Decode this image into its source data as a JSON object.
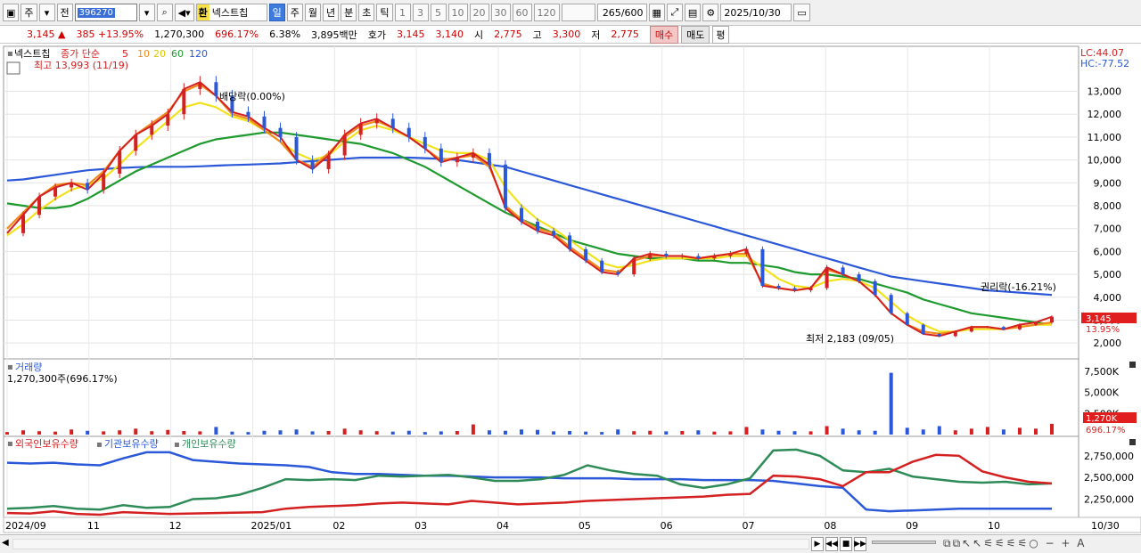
{
  "toolbar": {
    "type_label": "주",
    "prev_label": "전",
    "stock_code": "396270",
    "hwan_label": "환",
    "stock_name": "넥스트칩",
    "periods": [
      "일",
      "주",
      "월",
      "년",
      "분",
      "초",
      "틱"
    ],
    "active_period": "일",
    "intervals": [
      "1",
      "3",
      "5",
      "10",
      "20",
      "30",
      "60",
      "120"
    ],
    "count": "265",
    "count_max": "/600",
    "date": "2025/10/30"
  },
  "quote": {
    "price": "3,145",
    "change": "385",
    "change_pct": "+13.95%",
    "volume": "1,270,300",
    "volume_ratio": "696.17%",
    "turnover": "6.38%",
    "amount": "3,895백만",
    "bid_label": "호가",
    "ask": "3,145",
    "bid": "3,140",
    "open_label": "시",
    "open": "2,775",
    "high_label": "고",
    "high": "3,300",
    "low_label": "저",
    "low": "2,775",
    "buy_label": "매수",
    "sell_label": "매도",
    "flat_label": "평"
  },
  "price_panel": {
    "legend_name": "넥스트칩",
    "legend_ma": "종가 단순",
    "ma_labels": [
      "5",
      "10",
      "20",
      "60",
      "120"
    ],
    "ma_colors": [
      "#d42020",
      "#f08a1c",
      "#f2e21c",
      "#1e9a2e",
      "#2a58d8"
    ],
    "lc": "LC:44.07",
    "hc": "HC:-77.52",
    "high_note": "최고 13,993 (11/19)",
    "low_note": "최저 2,183 (09/05)",
    "dividend_note": "배당락(0.00%)",
    "rights_note": "권리락(-16.21%)",
    "current_price_tag": "3,145",
    "current_pct_tag": "13.95%",
    "y_ticks": [
      "13,000",
      "12,000",
      "11,000",
      "10,000",
      "9,000",
      "8,000",
      "7,000",
      "6,000",
      "5,000",
      "4,000",
      "3,000",
      "2,000"
    ]
  },
  "volume_panel": {
    "title": "거래량",
    "value": "1,270,300주(696.17%)",
    "y_ticks": [
      "7,500K",
      "5,000K",
      "2,500K"
    ],
    "tag_value": "1,270K",
    "tag_pct": "696.17%"
  },
  "holding_panel": {
    "series": [
      "외국인보유수량",
      "기관보유수량",
      "개인보유수량"
    ],
    "series_colors": [
      "#d42020",
      "#2a58d8",
      "#2e8b57"
    ],
    "y_ticks": [
      "2,750,000",
      "2,500,000",
      "2,250,000"
    ]
  },
  "x_axis": {
    "labels": [
      "2024/09",
      "11",
      "12",
      "2025/01",
      "02",
      "03",
      "04",
      "05",
      "06",
      "07",
      "08",
      "09",
      "10"
    ],
    "right_label": "10/30"
  },
  "chart_data": {
    "type": "line",
    "x_range": [
      "2024/09",
      "2025/10/30"
    ],
    "price": {
      "ylim": [
        1500,
        14500
      ],
      "closes": [
        6800,
        7600,
        8400,
        8800,
        9000,
        8700,
        9400,
        10400,
        11100,
        11500,
        12000,
        13100,
        13400,
        12800,
        12100,
        11900,
        11400,
        11000,
        10000,
        9600,
        10200,
        11100,
        11600,
        11800,
        11400,
        11000,
        10500,
        9900,
        10100,
        10300,
        9800,
        7900,
        7300,
        6900,
        6700,
        6100,
        5600,
        5100,
        5000,
        5700,
        5900,
        5800,
        5800,
        5700,
        5800,
        5900,
        6100,
        4500,
        4400,
        4300,
        4400,
        5300,
        5000,
        4700,
        4100,
        3300,
        2800,
        2400,
        2300,
        2500,
        2700,
        2700,
        2600,
        2800,
        2900,
        3145
      ],
      "ma5": [
        7000,
        7700,
        8400,
        8900,
        9000,
        8900,
        9500,
        10400,
        11100,
        11600,
        12100,
        13000,
        13300,
        12800,
        12000,
        11800,
        11300,
        10800,
        10000,
        9700,
        10300,
        11000,
        11500,
        11700,
        11400,
        11000,
        10500,
        10000,
        10100,
        10200,
        9700,
        8000,
        7400,
        7000,
        6800,
        6200,
        5700,
        5200,
        5100,
        5600,
        5800,
        5800,
        5800,
        5700,
        5800,
        5900,
        5900,
        4600,
        4400,
        4300,
        4400,
        5200,
        5000,
        4700,
        4100,
        3300,
        2800,
        2500,
        2400,
        2500,
        2700,
        2700,
        2600,
        2700,
        2800,
        2900
      ],
      "ma20": [
        6700,
        7200,
        7800,
        8300,
        8700,
        8900,
        9200,
        9800,
        10500,
        11100,
        11700,
        12300,
        12500,
        12300,
        11900,
        11700,
        11300,
        10800,
        10300,
        10000,
        10200,
        10800,
        11300,
        11500,
        11300,
        11000,
        10700,
        10400,
        10300,
        10300,
        10000,
        8800,
        8000,
        7400,
        7000,
        6500,
        6000,
        5500,
        5300,
        5400,
        5600,
        5700,
        5700,
        5700,
        5700,
        5800,
        5800,
        5300,
        4800,
        4500,
        4400,
        4700,
        4800,
        4700,
        4400,
        3800,
        3200,
        2800,
        2500,
        2500,
        2600,
        2600,
        2600,
        2700,
        2800,
        2800
      ],
      "ma60": [
        8100,
        8000,
        7900,
        7900,
        8000,
        8300,
        8700,
        9100,
        9500,
        9800,
        10100,
        10400,
        10700,
        10900,
        11000,
        11100,
        11200,
        11200,
        11100,
        11000,
        10900,
        10800,
        10700,
        10500,
        10300,
        10000,
        9700,
        9300,
        8900,
        8500,
        8100,
        7700,
        7400,
        7100,
        6800,
        6500,
        6300,
        6100,
        5900,
        5800,
        5700,
        5700,
        5700,
        5600,
        5600,
        5500,
        5500,
        5400,
        5300,
        5100,
        5000,
        5000,
        4900,
        4800,
        4600,
        4400,
        4200,
        3900,
        3700,
        3500,
        3300,
        3200,
        3100,
        3000,
        2900,
        2800
      ],
      "ma120": [
        9100,
        9150,
        9250,
        9350,
        9450,
        9550,
        9600,
        9650,
        9680,
        9700,
        9700,
        9700,
        9720,
        9750,
        9780,
        9800,
        9820,
        9850,
        9900,
        9950,
        10000,
        10050,
        10100,
        10100,
        10100,
        10100,
        10080,
        10050,
        10000,
        9900,
        9800,
        9700,
        9500,
        9300,
        9100,
        8900,
        8700,
        8500,
        8300,
        8100,
        7900,
        7700,
        7500,
        7300,
        7100,
        6900,
        6700,
        6500,
        6300,
        6100,
        5900,
        5700,
        5500,
        5300,
        5100,
        4900,
        4800,
        4700,
        4600,
        4500,
        4400,
        4300,
        4250,
        4200,
        4150,
        4100
      ]
    },
    "volume_k": [
      300,
      500,
      400,
      350,
      600,
      450,
      380,
      500,
      700,
      400,
      550,
      420,
      380,
      900,
      350,
      300,
      450,
      500,
      600,
      380,
      420,
      700,
      500,
      400,
      350,
      450,
      300,
      380,
      420,
      1200,
      500,
      450,
      600,
      550,
      380,
      420,
      350,
      300,
      600,
      400,
      450,
      380,
      420,
      500,
      350,
      380,
      900,
      600,
      450,
      400,
      380,
      1000,
      700,
      500,
      450,
      7300,
      800,
      600,
      1000,
      500,
      700,
      900,
      600,
      800,
      700,
      1270
    ],
    "holdings": {
      "foreign": [
        2090000,
        2085000,
        2110000,
        2080000,
        2070000,
        2100000,
        2090000,
        2080000,
        2085000,
        2090000,
        2095000,
        2100000,
        2140000,
        2160000,
        2170000,
        2180000,
        2200000,
        2210000,
        2200000,
        2190000,
        2230000,
        2210000,
        2190000,
        2200000,
        2210000,
        2230000,
        2240000,
        2250000,
        2260000,
        2270000,
        2280000,
        2300000,
        2310000,
        2520000,
        2510000,
        2480000,
        2400000,
        2560000,
        2560000,
        2680000,
        2760000,
        2750000,
        2570000,
        2500000,
        2450000,
        2430000
      ],
      "institution": [
        2670000,
        2660000,
        2670000,
        2650000,
        2640000,
        2720000,
        2790000,
        2790000,
        2700000,
        2680000,
        2660000,
        2650000,
        2640000,
        2620000,
        2560000,
        2540000,
        2540000,
        2530000,
        2520000,
        2520000,
        2510000,
        2500000,
        2500000,
        2500000,
        2490000,
        2490000,
        2490000,
        2480000,
        2480000,
        2480000,
        2470000,
        2470000,
        2470000,
        2460000,
        2430000,
        2400000,
        2380000,
        2130000,
        2110000,
        2120000,
        2130000,
        2140000,
        2140000,
        2140000,
        2140000,
        2140000
      ],
      "individual": [
        2140000,
        2150000,
        2170000,
        2140000,
        2130000,
        2180000,
        2150000,
        2160000,
        2250000,
        2260000,
        2300000,
        2380000,
        2480000,
        2470000,
        2480000,
        2470000,
        2520000,
        2510000,
        2520000,
        2530000,
        2500000,
        2460000,
        2460000,
        2480000,
        2530000,
        2640000,
        2580000,
        2540000,
        2520000,
        2420000,
        2380000,
        2420000,
        2490000,
        2810000,
        2820000,
        2750000,
        2580000,
        2560000,
        2600000,
        2510000,
        2480000,
        2450000,
        2440000,
        2450000,
        2420000,
        2430000
      ]
    }
  }
}
